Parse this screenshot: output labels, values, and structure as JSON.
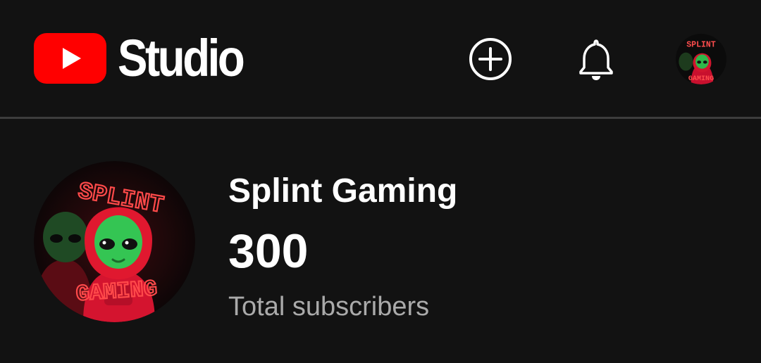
{
  "header": {
    "app_name": "Studio",
    "logo_color": "#ff0000",
    "actions": [
      {
        "icon": "create-plus-icon"
      },
      {
        "icon": "notifications-bell-icon"
      },
      {
        "icon": "account-avatar"
      }
    ]
  },
  "channel": {
    "name": "Splint Gaming",
    "subscriber_count": "300",
    "subscriber_label": "Total subscribers",
    "avatar_text_top": "SPLINT",
    "avatar_text_bottom": "GAMING",
    "avatar_accent": "#ff3b3b"
  }
}
